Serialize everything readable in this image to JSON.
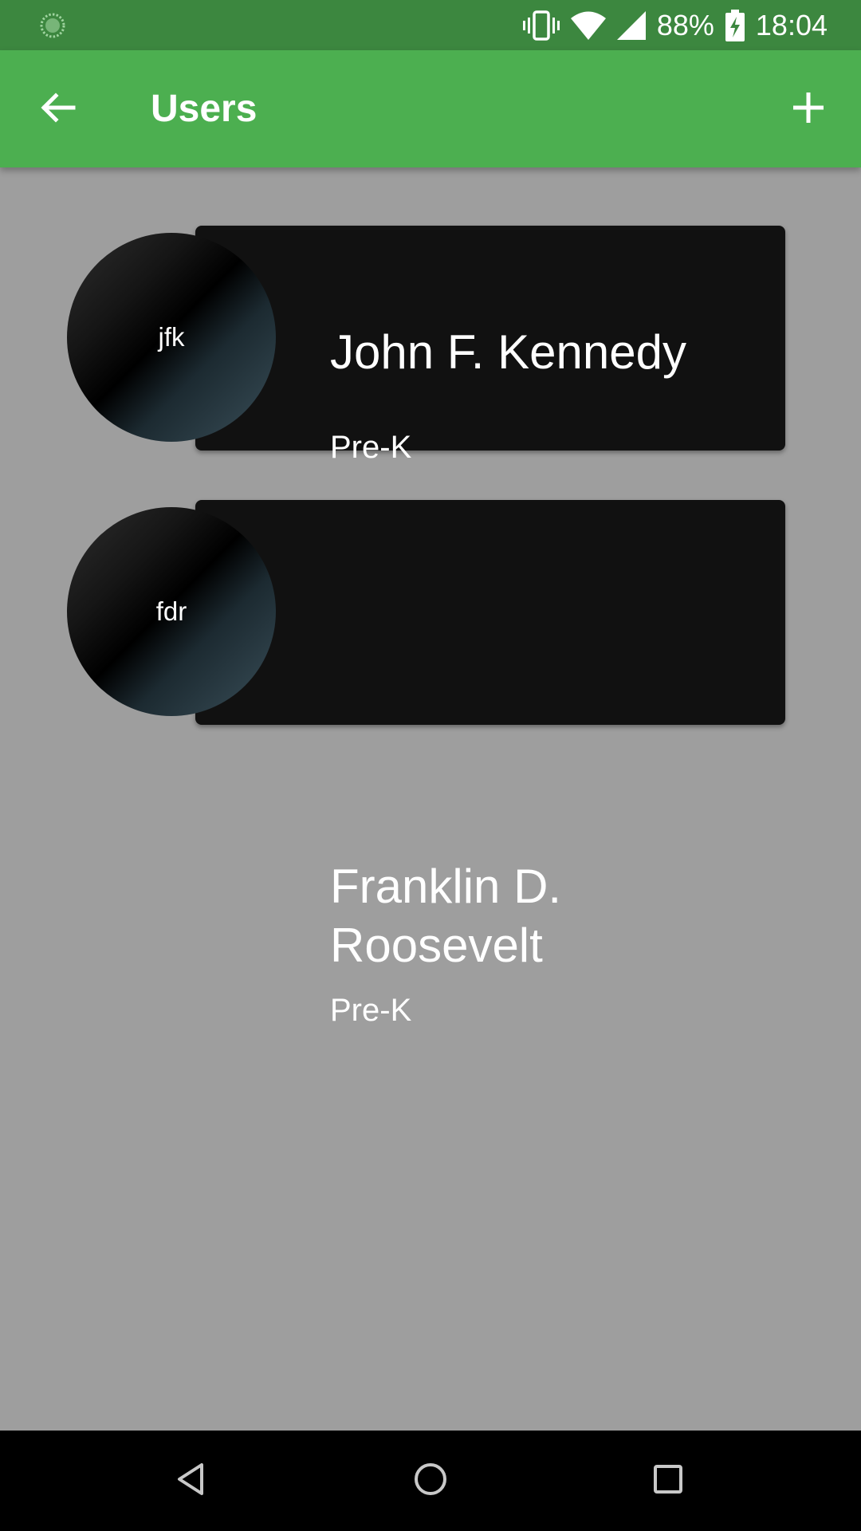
{
  "status_bar": {
    "battery_percent": "88%",
    "time": "18:04",
    "icons": [
      "loading-indicator-icon",
      "vibrate-icon",
      "wifi-icon",
      "cell-signal-icon",
      "battery-charging-icon"
    ]
  },
  "app_bar": {
    "title": "Users",
    "back_icon": "arrow-back-icon",
    "add_icon": "plus-icon"
  },
  "users": [
    {
      "initials": "jfk",
      "name": "John F. Kennedy",
      "grade": "Pre-K"
    },
    {
      "initials": "fdr",
      "name": "Franklin D. Roosevelt",
      "grade": "Pre-K"
    }
  ],
  "nav_bar": {
    "icons": [
      "nav-back-icon",
      "nav-home-icon",
      "nav-recents-icon"
    ]
  },
  "colors": {
    "status_bar": "#3c873f",
    "app_bar": "#4caf50",
    "background": "#9e9e9e",
    "card": "#111111"
  }
}
